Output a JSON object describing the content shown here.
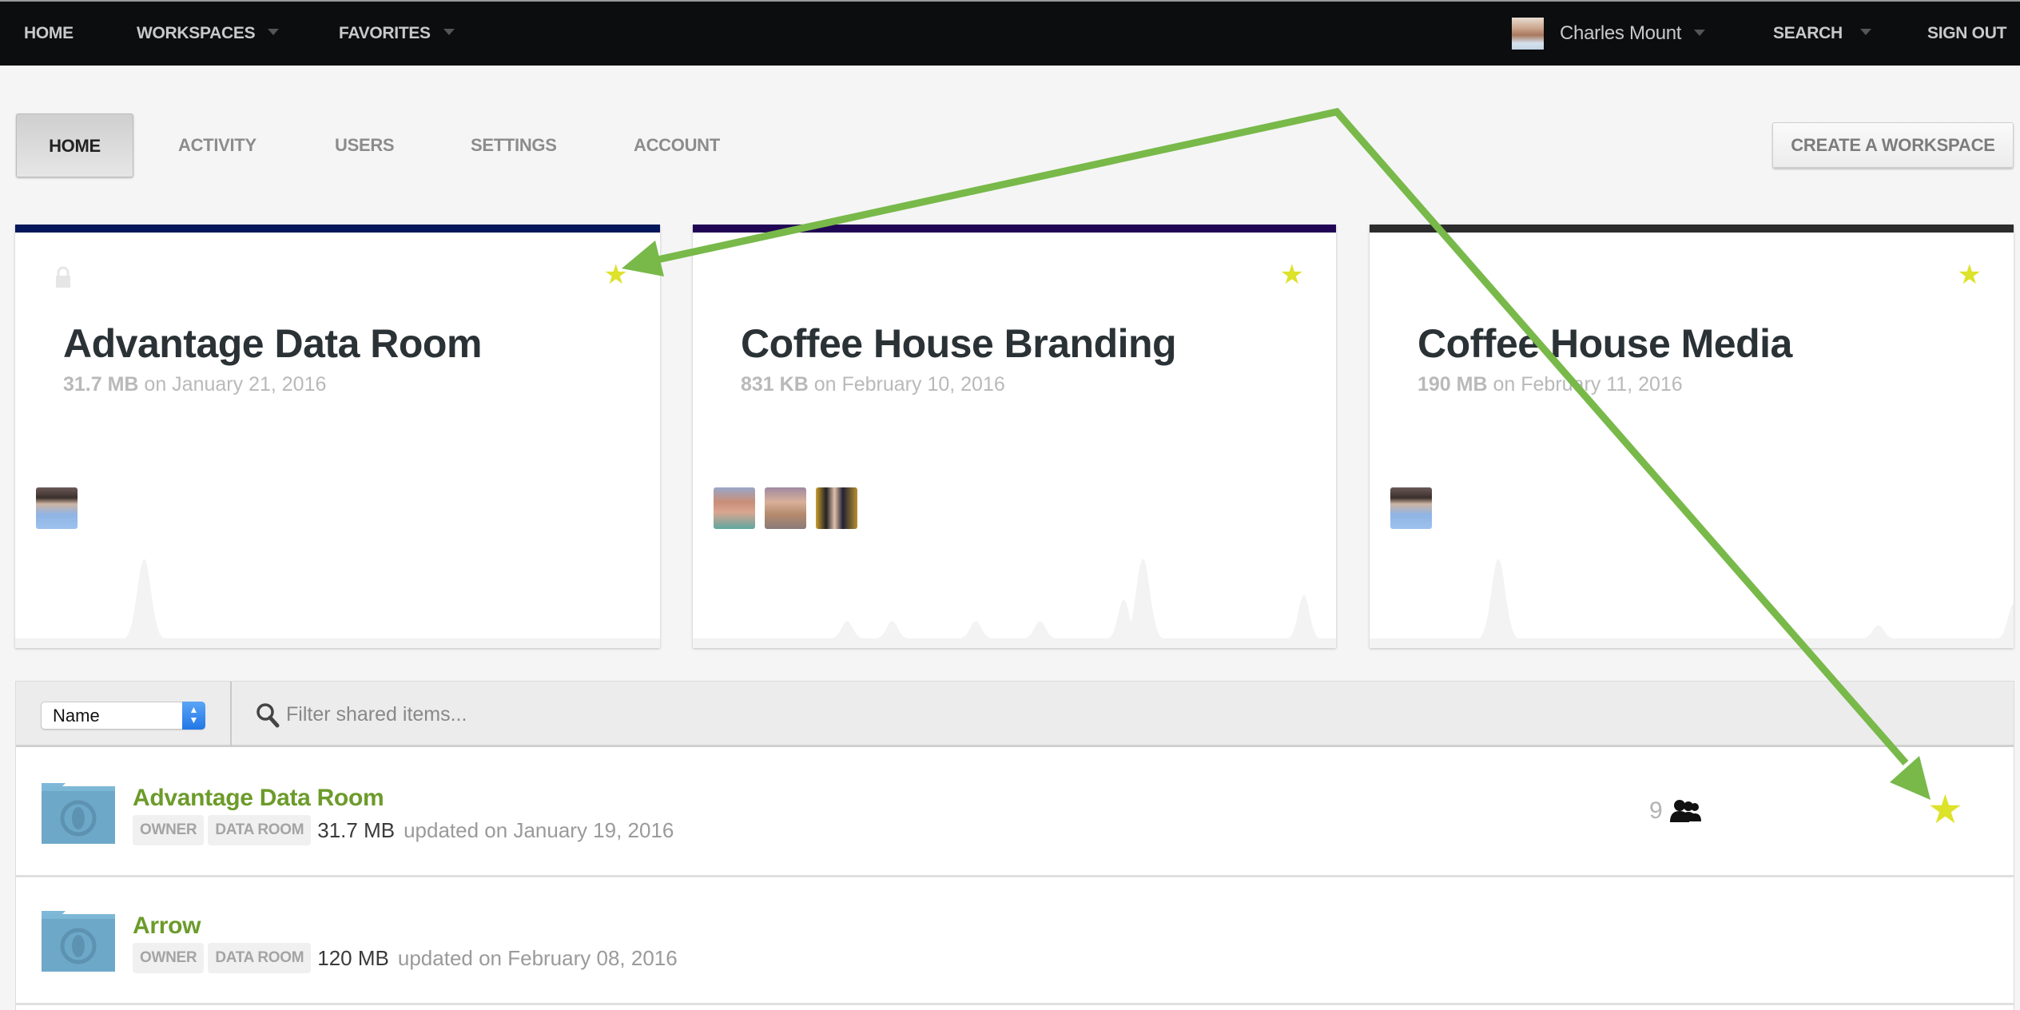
{
  "topnav": {
    "home": "HOME",
    "workspaces": "WORKSPACES",
    "favorites": "FAVORITES",
    "user_name": "Charles Mount",
    "search": "SEARCH",
    "sign_out": "SIGN OUT"
  },
  "subnav": {
    "tabs": [
      {
        "label": "HOME",
        "active": true
      },
      {
        "label": "ACTIVITY",
        "active": false
      },
      {
        "label": "USERS",
        "active": false
      },
      {
        "label": "SETTINGS",
        "active": false
      },
      {
        "label": "ACCOUNT",
        "active": false
      }
    ],
    "create_button": "CREATE A WORKSPACE"
  },
  "cards": [
    {
      "title": "Advantage Data Room",
      "size": "31.7 MB",
      "date": " on January 21, 2016",
      "locked": true,
      "favorite": true,
      "accent": "#03175a",
      "members": 1,
      "activity": [
        [
          0.2,
          0.92
        ]
      ]
    },
    {
      "title": "Coffee House Branding",
      "size": "831 KB",
      "date": " on February 10, 2016",
      "locked": false,
      "favorite": true,
      "accent": "#220656",
      "members": 3,
      "activity": [
        [
          0.24,
          0.2
        ],
        [
          0.31,
          0.2
        ],
        [
          0.44,
          0.2
        ],
        [
          0.54,
          0.2
        ],
        [
          0.67,
          0.45
        ],
        [
          0.7,
          0.92
        ],
        [
          0.95,
          0.5
        ]
      ]
    },
    {
      "title": "Coffee House Media",
      "size": "190 MB",
      "date": " on February 11, 2016",
      "locked": false,
      "favorite": true,
      "accent": "#2d2d2d",
      "members": 1,
      "activity": [
        [
          0.2,
          0.92
        ],
        [
          0.79,
          0.15
        ],
        [
          1.0,
          0.4
        ]
      ]
    }
  ],
  "list": {
    "sort_value": "Name",
    "filter_placeholder": "Filter shared items...",
    "items": [
      {
        "name": "Advantage Data Room",
        "tags": [
          "OWNER",
          "DATA ROOM"
        ],
        "size": "31.7 MB",
        "updated": "updated on January 19, 2016",
        "members": "9",
        "favorite": true
      },
      {
        "name": "Arrow",
        "tags": [
          "OWNER",
          "DATA ROOM"
        ],
        "size": "120 MB",
        "updated": "updated on February 08, 2016",
        "members": "",
        "favorite": false
      }
    ]
  },
  "colors": {
    "link_green": "#6c9b2a",
    "star_yellow": "#dde22a",
    "annotation_green": "#78b94a"
  }
}
